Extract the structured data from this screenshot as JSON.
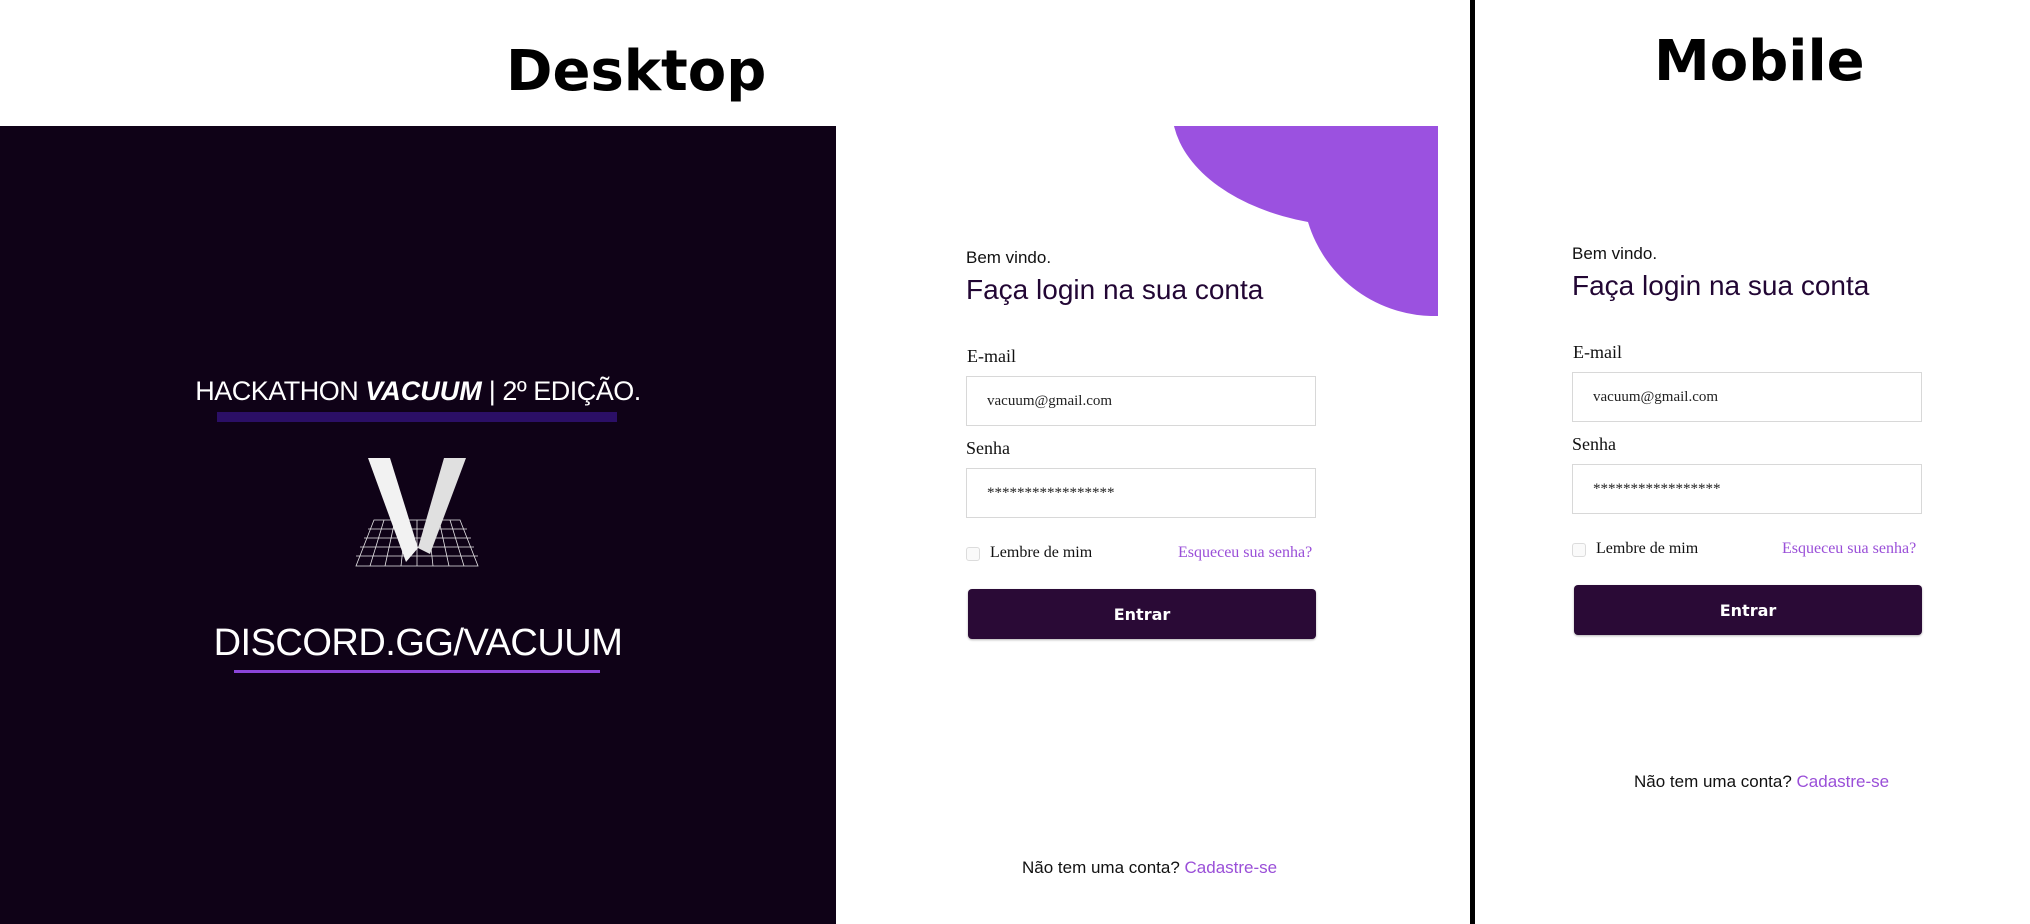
{
  "headings": {
    "desktop": "Desktop",
    "mobile": "Mobile"
  },
  "brand": {
    "event_prefix": "HACKATHON ",
    "event_name": "VACUUM",
    "event_suffix": " | 2º EDIÇÃO.",
    "logo_letter": "V",
    "discord": "DISCORD.GG/VACUUM"
  },
  "colors": {
    "dark_panel": "#0f0217",
    "accent_purple": "#9b51e0",
    "button": "#2a0a36",
    "link": "#9a4fd8"
  },
  "desktop_form": {
    "welcome": "Bem vindo.",
    "title": "Faça login na sua conta",
    "email_label": "E-mail",
    "email_value": "vacuum@gmail.com",
    "password_label": "Senha",
    "password_value": "*****************",
    "remember_label": "Lembre de mim",
    "forgot_link": "Esqueceu sua senha?",
    "submit_label": "Entrar",
    "no_account_text": "Não tem uma conta? ",
    "signup_link": "Cadastre-se"
  },
  "mobile_form": {
    "welcome": "Bem vindo.",
    "title": "Faça login na sua conta",
    "email_label": "E-mail",
    "email_value": "vacuum@gmail.com",
    "password_label": "Senha",
    "password_value": "*****************",
    "remember_label": "Lembre de mim",
    "forgot_link": "Esqueceu sua senha?",
    "submit_label": "Entrar",
    "no_account_text": "Não tem uma conta? ",
    "signup_link": "Cadastre-se"
  }
}
